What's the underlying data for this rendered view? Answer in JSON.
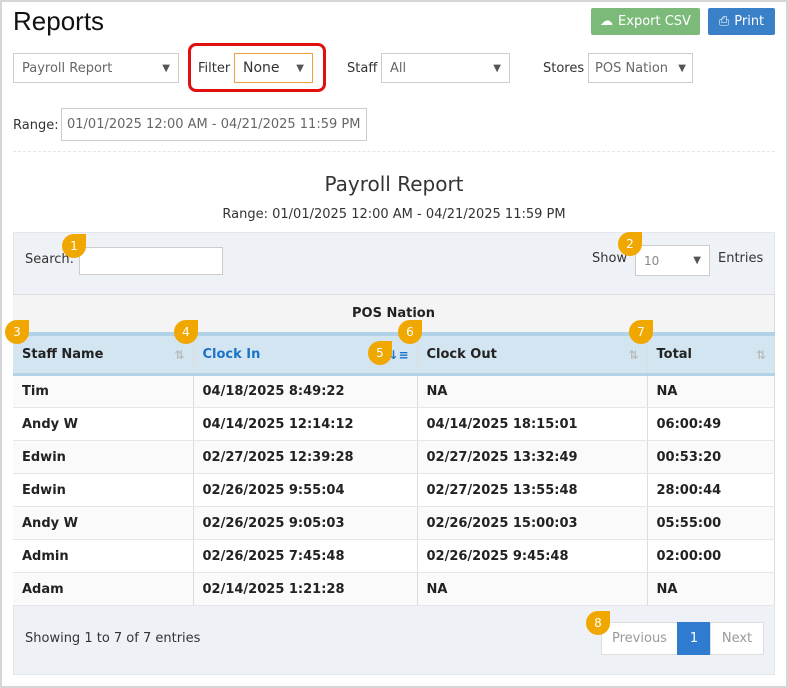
{
  "header": {
    "title": "Reports",
    "export_label": "Export CSV",
    "print_label": "Print"
  },
  "filters": {
    "report": "Payroll Report",
    "filter_label": "Filter",
    "filter_value": "None",
    "staff_label": "Staff",
    "staff_value": "All",
    "stores_label": "Stores",
    "stores_value": "POS Nation",
    "range_label": "Range:",
    "range_value": "01/01/2025 12:00 AM - 04/21/2025 11:59 PM"
  },
  "report": {
    "title": "Payroll Report",
    "subtitle": "Range: 01/01/2025 12:00 AM - 04/21/2025 11:59 PM"
  },
  "controls": {
    "search_label": "Search:",
    "search_value": "",
    "show_label": "Show",
    "show_value": "10",
    "entries_label": "Entries"
  },
  "table": {
    "group": "POS Nation",
    "columns": [
      "Staff Name",
      "Clock In",
      "Clock Out",
      "Total"
    ],
    "rows": [
      [
        "Tim",
        "04/18/2025 8:49:22",
        "NA",
        "NA"
      ],
      [
        "Andy W",
        "04/14/2025 12:14:12",
        "04/14/2025 18:15:01",
        "06:00:49"
      ],
      [
        "Edwin",
        "02/27/2025 12:39:28",
        "02/27/2025 13:32:49",
        "00:53:20"
      ],
      [
        "Edwin",
        "02/26/2025 9:55:04",
        "02/27/2025 13:55:48",
        "28:00:44"
      ],
      [
        "Andy W",
        "02/26/2025 9:05:03",
        "02/26/2025 15:00:03",
        "05:55:00"
      ],
      [
        "Admin",
        "02/26/2025 7:45:48",
        "02/26/2025 9:45:48",
        "02:00:00"
      ],
      [
        "Adam",
        "02/14/2025 1:21:28",
        "NA",
        "NA"
      ]
    ]
  },
  "footer": {
    "info": "Showing 1 to 7 of 7 entries",
    "previous": "Previous",
    "page": "1",
    "next": "Next"
  },
  "callouts": [
    "1",
    "2",
    "3",
    "4",
    "5",
    "6",
    "7",
    "8"
  ],
  "colors": {
    "export": "#7cba7a",
    "print": "#3a80c8",
    "accent": "#1a73c9",
    "callout": "#f0a800",
    "highlight": "#e01010"
  }
}
